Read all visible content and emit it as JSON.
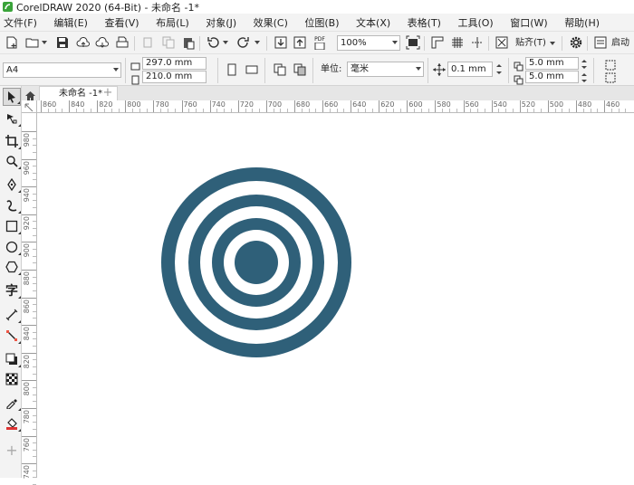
{
  "window": {
    "title": "CorelDRAW 2020 (64-Bit) - 未命名 -1*"
  },
  "menu": [
    "文件(F)",
    "编辑(E)",
    "查看(V)",
    "布局(L)",
    "对象(J)",
    "效果(C)",
    "位图(B)",
    "文本(X)",
    "表格(T)",
    "工具(O)",
    "窗口(W)",
    "帮助(H)"
  ],
  "standard_toolbar": {
    "zoom_value": "100%",
    "snap_label": "贴齐(T)",
    "launch_label": "启动",
    "pdf_label": "PDF"
  },
  "property_bar": {
    "page_size": "A4",
    "width": "297.0 mm",
    "height": "210.0 mm",
    "units_label": "单位:",
    "units_value": "毫米",
    "nudge": "0.1 mm",
    "dup_x": "5.0 mm",
    "dup_y": "5.0 mm"
  },
  "document_tab": {
    "label": "未命名 -1*"
  },
  "rulers": {
    "horizontal_ticks": [
      "860",
      "840",
      "820",
      "800",
      "780",
      "760",
      "740",
      "720",
      "700",
      "680",
      "660",
      "640",
      "620",
      "600",
      "580",
      "560",
      "540",
      "520",
      "500",
      "480",
      "460"
    ],
    "vertical_ticks": [
      "980",
      "960",
      "940",
      "920",
      "900",
      "880",
      "860",
      "840",
      "820",
      "800",
      "780",
      "760",
      "740"
    ]
  },
  "artwork": {
    "color": "#2f6079",
    "type": "concentric-rings"
  }
}
